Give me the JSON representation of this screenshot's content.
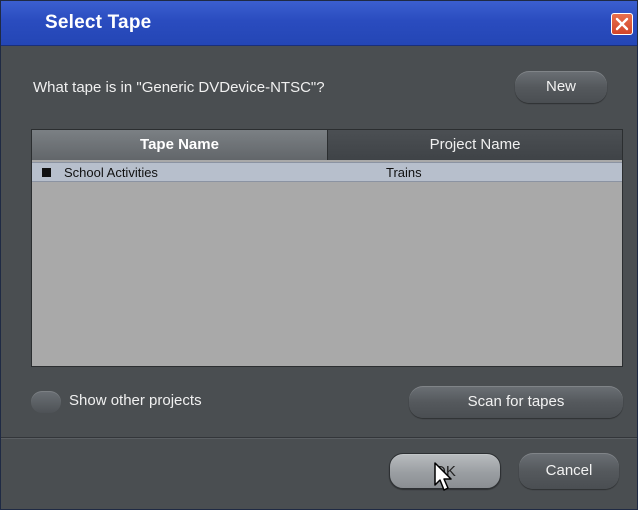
{
  "window": {
    "title": "Select Tape"
  },
  "prompt": {
    "text": "What tape is in \"Generic DVDevice-NTSC\"?"
  },
  "buttons": {
    "new": "New",
    "scan": "Scan for tapes",
    "ok": "OK",
    "cancel": "Cancel"
  },
  "table": {
    "columns": [
      "Tape Name",
      "Project Name"
    ],
    "rows": [
      {
        "tape": "School Activities",
        "project": "Trains",
        "selected": true
      }
    ]
  },
  "options": {
    "show_other_projects": "Show other projects"
  },
  "colors": {
    "title_bar": "#2a4cbf",
    "window_bg": "#4a4e51",
    "table_bg": "#a9a9a9",
    "selected_row": "#b7bfcc",
    "close_button": "#d2452a"
  },
  "icons": {
    "close": "close-icon",
    "cursor": "mouse-pointer-icon"
  }
}
